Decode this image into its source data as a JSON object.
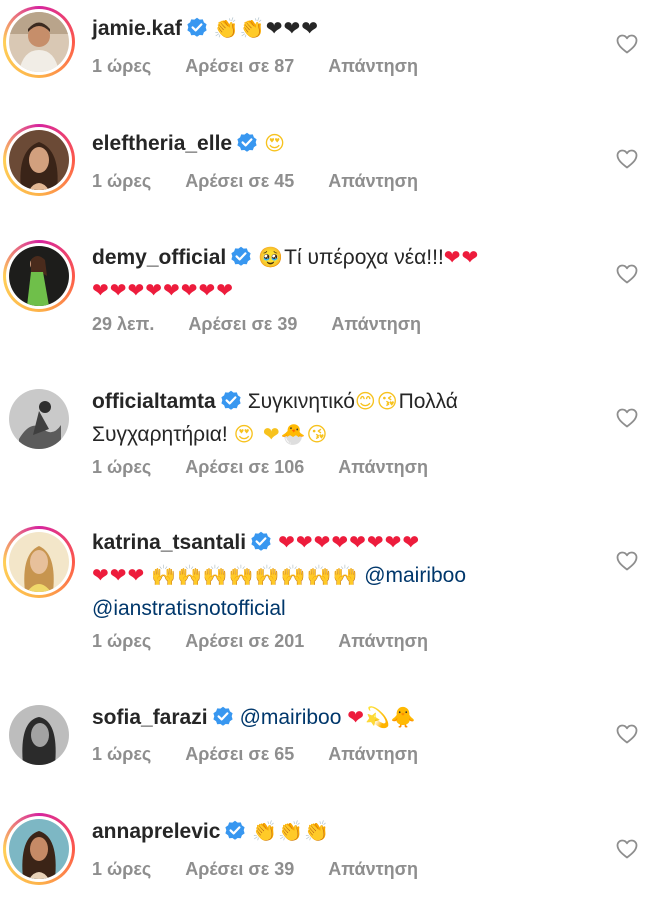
{
  "comments": [
    {
      "username": "jamie.kaf",
      "text": "",
      "emojis": "👏👏❤❤❤",
      "time": "1 ώρες",
      "likes": "Αρέσει σε 87",
      "reply": "Απάντηση"
    },
    {
      "username": "eleftheria_elle",
      "text": "",
      "emojis": "😍",
      "time": "1 ώρες",
      "likes": "Αρέσει σε 45",
      "reply": "Απάντηση"
    },
    {
      "username": "demy_official",
      "text": "Τί υπέροχα νέα!!!",
      "emojis_pre": "🥹",
      "emojis": "❤❤",
      "emojis_line2": "❤❤❤❤❤❤❤❤",
      "time": "29 λεπ.",
      "likes": "Αρέσει σε 39",
      "reply": "Απάντηση"
    },
    {
      "username": "officialtamta",
      "text": "Συγκινητικό",
      "emoji_a": "😊",
      "emoji_b": "😘",
      "text2": "Πολλά",
      "text_line2": "Συγχαρητήρια!",
      "emojis_line2": "😍 ❤🐣😘",
      "time": "1 ώρες",
      "likes": "Αρέσει σε 106",
      "reply": "Απάντηση"
    },
    {
      "username": "katrina_tsantali",
      "emojis": "❤❤❤❤❤❤❤❤",
      "emojis_line2": "❤❤❤",
      "emojis_hands": "🙌🙌🙌🙌🙌🙌🙌🙌",
      "mention1": "@mairiboo",
      "mention2": "@ianstratisnotofficial",
      "time": "1 ώρες",
      "likes": "Αρέσει σε 201",
      "reply": "Απάντηση"
    },
    {
      "username": "sofia_farazi",
      "mention1": "@mairiboo",
      "emojis": "❤💫🐥",
      "time": "1 ώρες",
      "likes": "Αρέσει σε 65",
      "reply": "Απάντηση"
    },
    {
      "username": "annaprelevic",
      "emojis": "👏👏👏",
      "time": "1 ώρες",
      "likes": "Αρέσει σε 39",
      "reply": "Απάντηση"
    }
  ],
  "colors": {
    "username": "#262626",
    "meta": "#8e8e8e",
    "mention": "#00376b",
    "verified": "#3897f0",
    "heart": "#ed1c3c"
  },
  "icons": {
    "verified": "verified-badge-icon",
    "like": "heart-outline-icon"
  }
}
